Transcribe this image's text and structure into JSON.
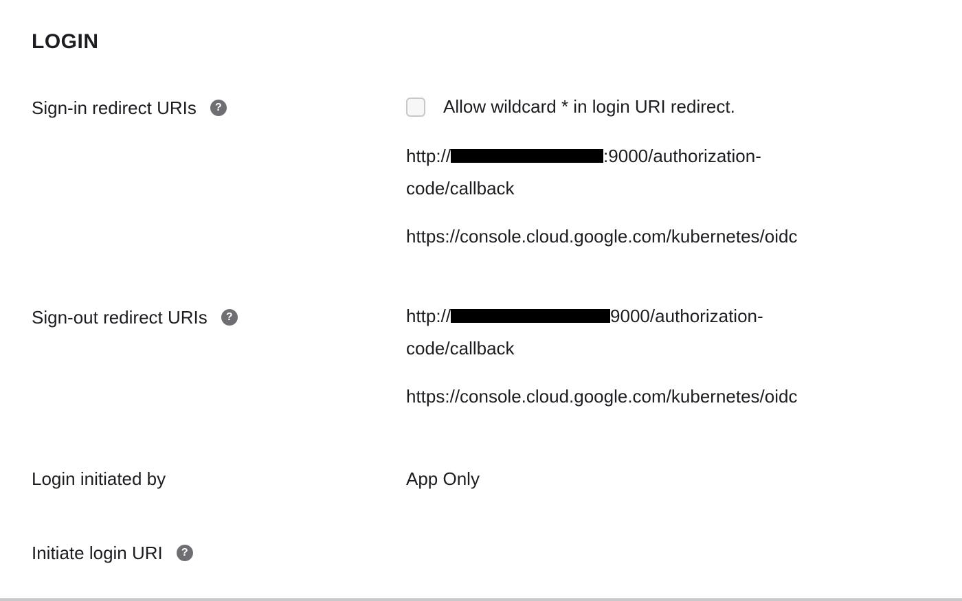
{
  "section": {
    "title": "LOGIN"
  },
  "signin": {
    "label": "Sign-in redirect URIs",
    "help_icon": "question-circle-icon",
    "wildcard_checkbox_label": "Allow wildcard * in login URI redirect.",
    "wildcard_checked": false,
    "uri1_prefix": "http://",
    "uri1_suffix": ":9000/authorization-",
    "uri1_line2": "code/callback",
    "uri2": "https://console.cloud.google.com/kubernetes/oidc"
  },
  "signout": {
    "label": "Sign-out redirect URIs",
    "help_icon": "question-circle-icon",
    "uri1_prefix": "http://",
    "uri1_suffix": "9000/authorization-",
    "uri1_line2": "code/callback",
    "uri2": "https://console.cloud.google.com/kubernetes/oidc"
  },
  "login_initiated": {
    "label": "Login initiated by",
    "value": "App Only"
  },
  "initiate_uri": {
    "label": "Initiate login URI",
    "help_icon": "question-circle-icon"
  },
  "icons": {
    "help_glyph": "?"
  }
}
